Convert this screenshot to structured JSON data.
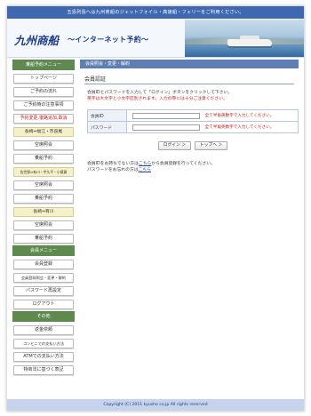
{
  "topbar": {
    "text": "五島列島へは九州商船のジェットフォイル・高速船・フェリーをご利用ください。"
  },
  "header": {
    "logo": "九州商船",
    "tagline": "～インターネット予約～"
  },
  "sidebar": {
    "reservation_menu_title": "乗船予約メニュー",
    "reservation_items": [
      "トップページ",
      "ご予約の流れ",
      "ご予約時の注意事項",
      "予約変更,復路追加,取消"
    ],
    "route1_title": "長崎⇔福江・奈良尾",
    "route1_items": [
      "空席照会",
      "乗船予約"
    ],
    "route2_title": "佐世保⇔有川・宇久平・小値賀",
    "route2_items": [
      "空席照会",
      "乗船予約"
    ],
    "route3_title": "長崎⇔有川",
    "route3_items": [
      "空席照会",
      "乗船予約"
    ],
    "member_menu_title": "会員メニュー",
    "member_items": [
      "会員登録",
      "会員登録照会・変更・解約",
      "パスワード再設定",
      "ログアウト"
    ],
    "other_title": "その他",
    "other_items": [
      "返金依頼",
      "コンビニでの支払い方法",
      "ATMでの支払い方法",
      "特商法に基づく表記"
    ]
  },
  "main": {
    "heading": "会員照会・変更・解約",
    "section_title": "会員認証",
    "desc_line1": "会員IDとパスワードを入力して「ログイン」ボタンをクリックして下さい。",
    "desc_line2": "英字は大文字と小文字区別されます。入力の際には十分ご注意ください。",
    "member_id_label": "会員ID",
    "member_id_value": "",
    "member_id_hint": "全て半角英数字で入力してください。",
    "password_label": "パスワード",
    "password_value": "",
    "password_hint": "全て半角英数字で入力してください。",
    "login_button": "ログイン ＞",
    "top_button": "トップへ ＞",
    "note_line1_prefix": "会員IDをお持ちでない方は",
    "note_line1_link": "こちら",
    "note_line1_suffix": "から会員登録を行ってください。",
    "note_line2_prefix": "パスワードをお忘れの方は",
    "note_line2_link": "こちら"
  },
  "footer": {
    "copyright": "Copyright (C) 2011 kyusho co.jp All rights reserved"
  },
  "colors": {
    "topbar": "#3f68b0",
    "side_head": "#5f8a4f",
    "main_head": "#5e7fb3",
    "warn": "#c21a1a",
    "footer": "#c5d4ec"
  }
}
